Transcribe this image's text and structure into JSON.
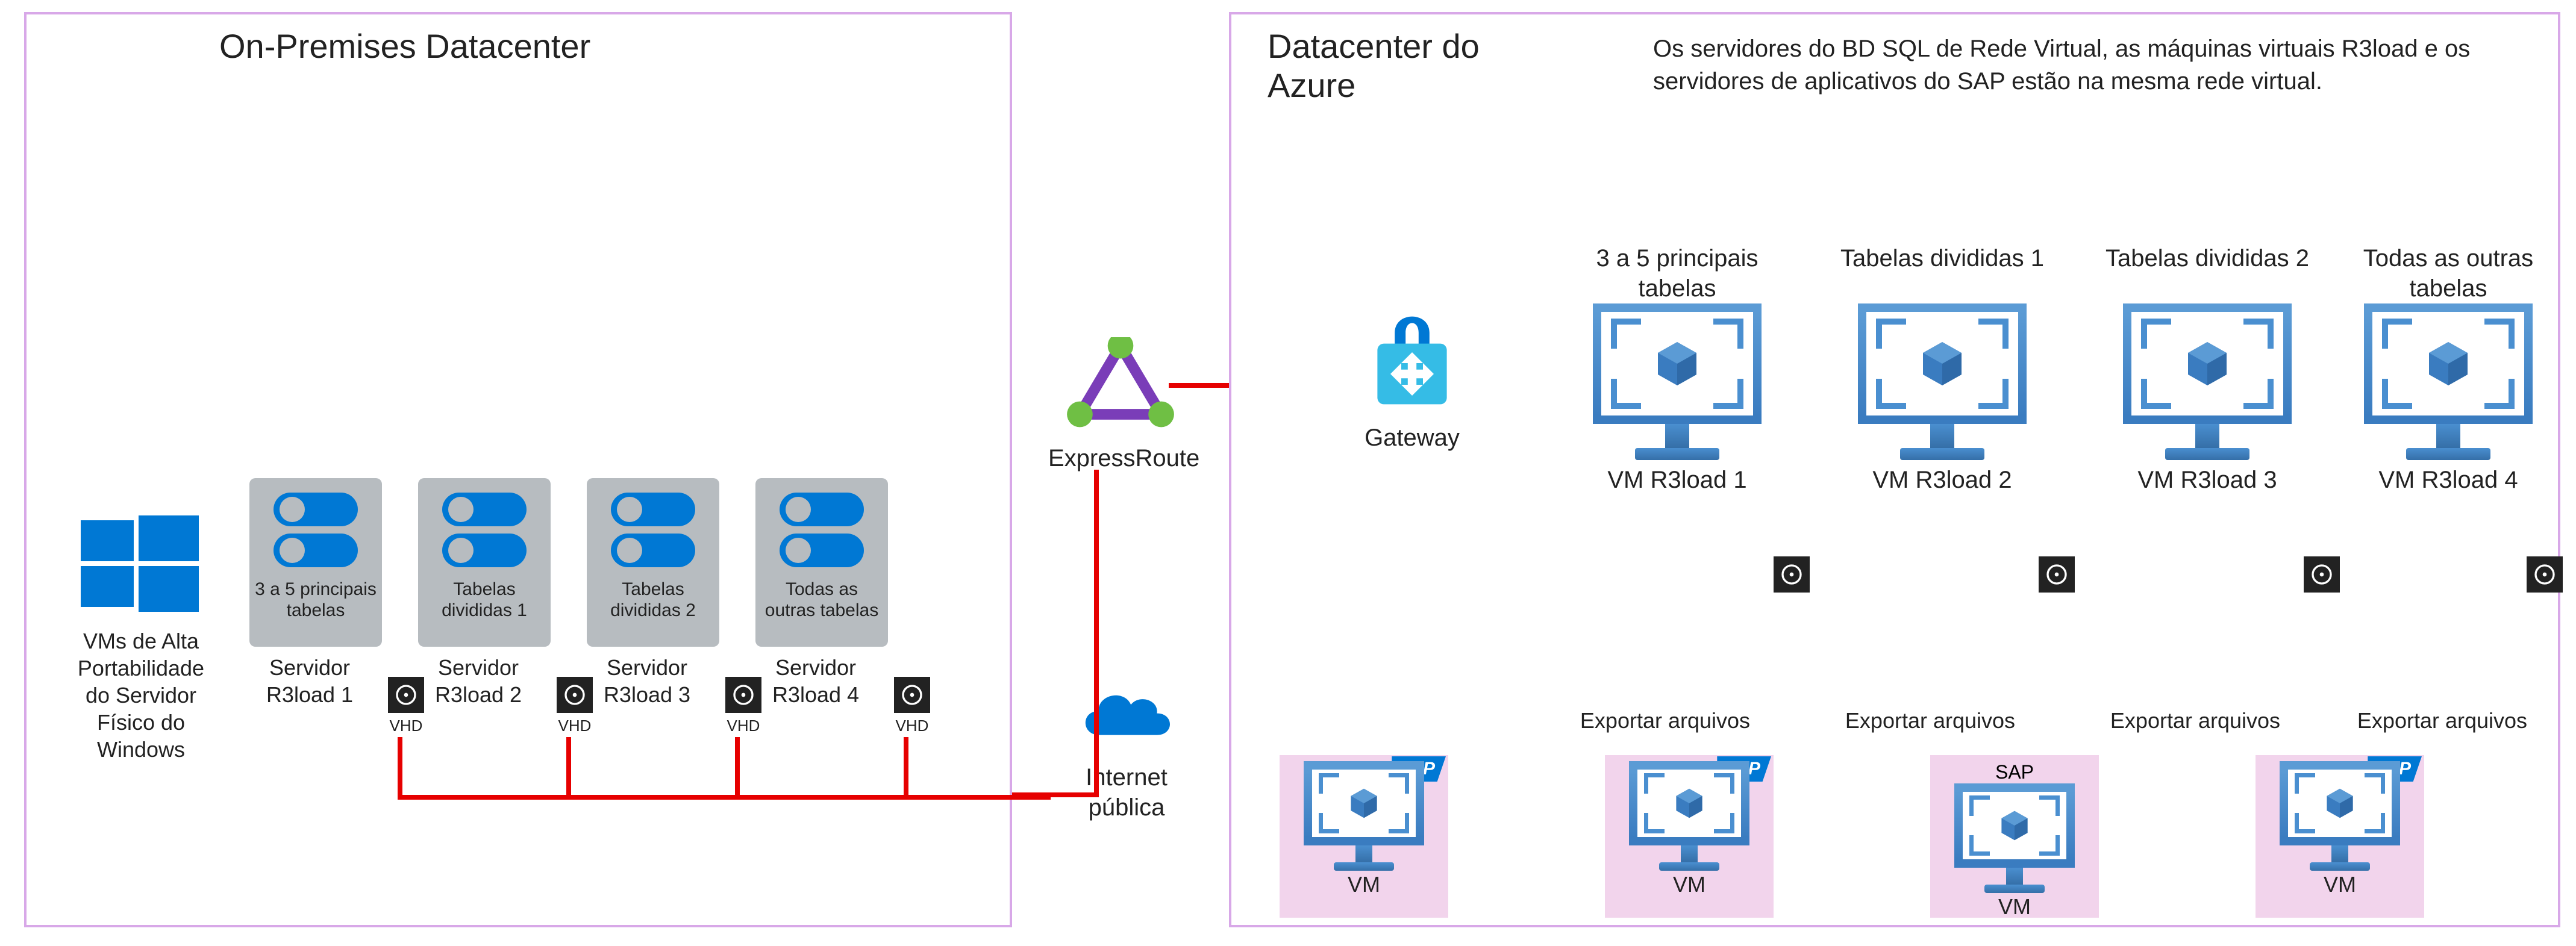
{
  "onprem": {
    "title": "On-Premises Datacenter",
    "windows_label": "VMs de Alta Portabilidade do Servidor Físico do Windows",
    "servers": [
      {
        "box": "3 a 5 principais tabelas",
        "below": "Servidor R3load 1",
        "vhd": "VHD"
      },
      {
        "box": "Tabelas divididas 1",
        "below": "Servidor R3load 2",
        "vhd": "VHD"
      },
      {
        "box": "Tabelas divididas 2",
        "below": "Servidor R3load 3",
        "vhd": "VHD"
      },
      {
        "box": "Todas as outras tabelas",
        "below": "Servidor R3load 4",
        "vhd": "VHD"
      }
    ]
  },
  "middle": {
    "expressroute": "ExpressRoute",
    "internet": "Internet pública"
  },
  "azure": {
    "title": "Datacenter do Azure",
    "description": "Os servidores do BD SQL de Rede Virtual, as máquinas virtuais R3load e os servidores de aplicativos do SAP estão na mesma rede virtual.",
    "gateway": "Gateway",
    "vms": [
      {
        "top": "3 a 5 principais tabelas",
        "name": "VM R3load 1",
        "export": "Exportar arquivos"
      },
      {
        "top": "Tabelas divididas 1",
        "name": "VM R3load 2",
        "export": "Exportar arquivos"
      },
      {
        "top": "Tabelas divididas 2",
        "name": "VM R3load 3",
        "export": "Exportar arquivos"
      },
      {
        "top": "Todas as outras tabelas",
        "name": "VM R3load 4",
        "export": "Exportar arquivos"
      }
    ],
    "sap_vm_label": "VM",
    "sap_text": "SAP"
  }
}
